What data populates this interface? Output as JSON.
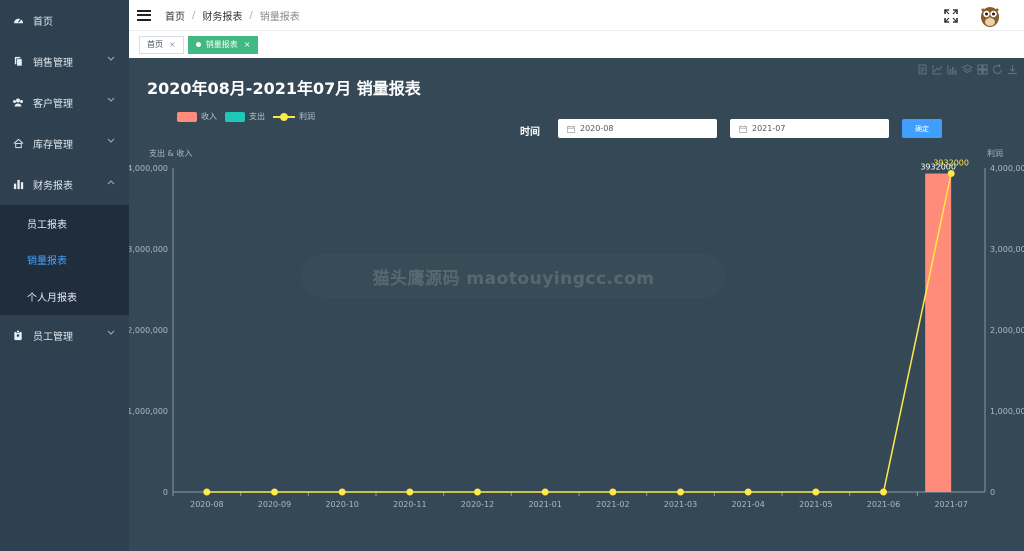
{
  "sidebar": {
    "items": [
      {
        "label": "首页",
        "icon": "dashboard-icon",
        "expandable": false
      },
      {
        "label": "销售管理",
        "icon": "document-icon",
        "expandable": true
      },
      {
        "label": "客户管理",
        "icon": "users-icon",
        "expandable": true
      },
      {
        "label": "库存管理",
        "icon": "home-icon",
        "expandable": true
      },
      {
        "label": "财务报表",
        "icon": "bar-chart-icon",
        "expandable": true,
        "open": true
      },
      {
        "label": "员工管理",
        "icon": "badge-icon",
        "expandable": true
      }
    ],
    "submenu": [
      {
        "label": "员工报表",
        "active": false
      },
      {
        "label": "销量报表",
        "active": true
      },
      {
        "label": "个人月报表",
        "active": false
      }
    ]
  },
  "header": {
    "breadcrumb": [
      "首页",
      "财务报表",
      "销量报表"
    ]
  },
  "tags": [
    {
      "label": "首页",
      "active": false
    },
    {
      "label": "销量报表",
      "active": true
    }
  ],
  "main": {
    "title": "2020年08月-2021年07月 销量报表",
    "filter_label": "时间",
    "start_date": "2020-08",
    "end_date": "2021-07",
    "confirm_label": "确定",
    "watermark": "猫头鹰源码 maotouyingcc.com"
  },
  "colors": {
    "income": "#ff8c7a",
    "expense": "#1ec7b6",
    "profit": "#ffe84c",
    "background": "#344955",
    "accent": "#409eff"
  },
  "chart_data": {
    "type": "bar",
    "categories": [
      "2020-08",
      "2020-09",
      "2020-10",
      "2020-11",
      "2020-12",
      "2021-01",
      "2021-02",
      "2021-03",
      "2021-04",
      "2021-05",
      "2021-06",
      "2021-07"
    ],
    "series": [
      {
        "name": "收入",
        "type": "bar",
        "axis": "left",
        "values": [
          0,
          0,
          0,
          0,
          0,
          0,
          0,
          0,
          0,
          0,
          0,
          3932000
        ]
      },
      {
        "name": "支出",
        "type": "bar",
        "axis": "left",
        "values": [
          0,
          0,
          0,
          0,
          0,
          0,
          0,
          0,
          0,
          0,
          0,
          0
        ]
      },
      {
        "name": "利润",
        "type": "line",
        "axis": "right",
        "values": [
          0,
          0,
          0,
          0,
          0,
          0,
          0,
          0,
          0,
          0,
          0,
          3932000
        ]
      }
    ],
    "left_axis_label": "支出 & 收入",
    "right_axis_label": "利润",
    "ylim": [
      0,
      4000000
    ],
    "y_ticks": [
      "0",
      "1,000,000",
      "2,000,000",
      "3,000,000",
      "4,000,000"
    ],
    "data_labels": [
      {
        "series": "收入",
        "category": "2021-07",
        "text": "3932000"
      },
      {
        "series": "利润",
        "category": "2021-07",
        "text": "3932000"
      }
    ],
    "legend": [
      "收入",
      "支出",
      "利润"
    ],
    "legend_position": "top-left",
    "grid": false
  }
}
